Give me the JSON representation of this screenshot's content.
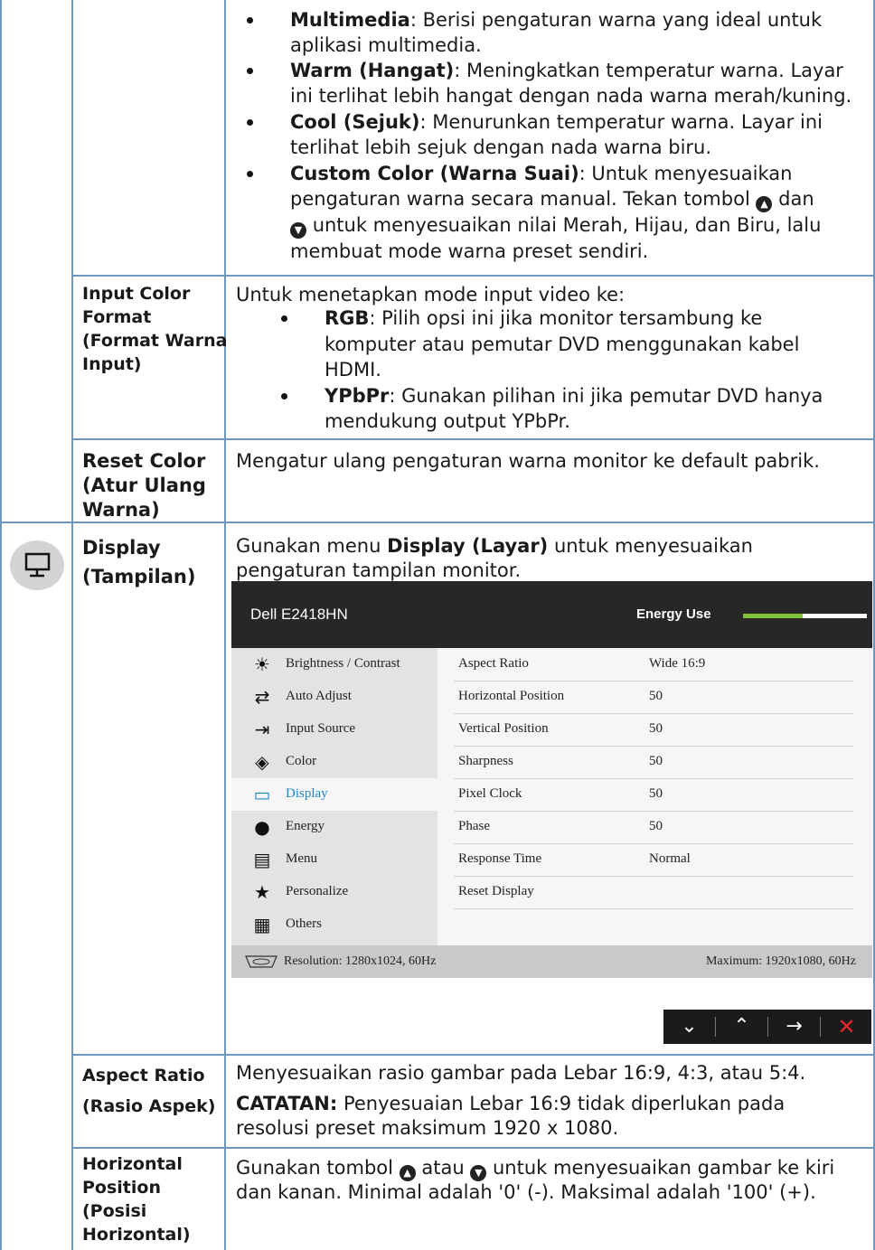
{
  "section_color_presets": {
    "items": [
      {
        "term": "Multimedia",
        "rest_line1": ": Berisi pengaturan warna yang ideal untuk",
        "rest_line2": "aplikasi multimedia."
      },
      {
        "term": "Warm (Hangat)",
        "rest_line1": ": Meningkatkan temperatur warna. Layar",
        "rest_line2": "ini terlihat lebih hangat dengan nada warna merah/kuning."
      },
      {
        "term": "Cool (Sejuk)",
        "rest_line1": ": Menurunkan temperatur warna. Layar ini",
        "rest_line2": "terlihat lebih sejuk dengan nada warna biru."
      }
    ],
    "custom": {
      "term": "Custom Color (Warna Suai)",
      "line1_rest": ": Untuk menyesuaikan",
      "line2_a": "pengaturan warna secara manual. Tekan tombol",
      "line2_b": "dan",
      "line3": "untuk menyesuaikan nilai Merah, Hijau, dan Biru, lalu",
      "line4": "membuat mode warna preset sendiri."
    }
  },
  "input_color_format": {
    "label_lines": [
      "Input Color",
      "Format",
      "(Format Warna",
      "Input)"
    ],
    "intro": "Untuk menetapkan mode input video ke:",
    "rgb_term": "RGB",
    "rgb_line1": ": Pilih opsi ini jika monitor tersambung ke",
    "rgb_line2": "komputer atau pemutar DVD menggunakan kabel",
    "rgb_line3": "HDMI.",
    "ypbpr_term": "YPbPr",
    "ypbpr_line1": ": Gunakan pilihan ini jika pemutar DVD hanya",
    "ypbpr_line2": "mendukung output YPbPr."
  },
  "reset_color": {
    "label_lines": [
      "Reset Color",
      "(Atur Ulang",
      "Warna)"
    ],
    "desc": "Mengatur ulang pengaturan warna monitor ke default pabrik."
  },
  "display": {
    "label_lines": [
      "Display",
      "(Tampilan)"
    ],
    "desc_a": "Gunakan menu ",
    "desc_bold": "Display (Layar)",
    "desc_b": " untuk menyesuaikan",
    "desc_line2": "pengaturan tampilan monitor."
  },
  "osd": {
    "title": "Dell E2418HN",
    "energy_label": "Energy Use",
    "energy_level": 0.48,
    "energy_color": "#7ec33b",
    "menu": [
      {
        "label": "Brightness / Contrast",
        "icon": "sun-icon"
      },
      {
        "label": "Auto Adjust",
        "icon": "auto-adjust-icon"
      },
      {
        "label": "Input Source",
        "icon": "input-source-icon"
      },
      {
        "label": "Color",
        "icon": "color-icon"
      },
      {
        "label": "Display",
        "icon": "display-icon",
        "active": true
      },
      {
        "label": "Energy",
        "icon": "energy-icon"
      },
      {
        "label": "Menu",
        "icon": "menu-icon"
      },
      {
        "label": "Personalize",
        "icon": "star-icon"
      },
      {
        "label": "Others",
        "icon": "others-icon"
      }
    ],
    "rows": [
      {
        "label": "Aspect Ratio",
        "value": "Wide 16:9"
      },
      {
        "label": "Horizontal Position",
        "value": "50"
      },
      {
        "label": "Vertical Position",
        "value": "50"
      },
      {
        "label": "Sharpness",
        "value": "50"
      },
      {
        "label": "Pixel Clock",
        "value": "50"
      },
      {
        "label": "Phase",
        "value": "50"
      },
      {
        "label": "Response Time",
        "value": "Normal"
      },
      {
        "label": "Reset Display",
        "value": ""
      }
    ],
    "resolution": "Resolution: 1280x1024, 60Hz",
    "maximum": "Maximum: 1920x1080, 60Hz",
    "accent_color": "#1f86c9"
  },
  "aspect_ratio": {
    "label_lines": [
      "Aspect Ratio",
      "(Rasio Aspek)"
    ],
    "desc": "Menyesuaikan rasio gambar pada Lebar 16:9, 4:3, atau 5:4.",
    "note_bold": "CATATAN:",
    "note_line1": " Penyesuaian Lebar 16:9 tidak diperlukan pada",
    "note_line2": "resolusi preset maksimum 1920 x 1080."
  },
  "horizontal_position": {
    "label_lines": [
      "Horizontal",
      "Position",
      "(Posisi",
      "Horizontal)"
    ],
    "line1_a": "Gunakan tombol",
    "line1_b": "atau",
    "line1_c": "untuk menyesuaikan gambar ke kiri",
    "line2": "dan kanan. Minimal adalah '0' (-). Maksimal adalah '100' (+)."
  }
}
